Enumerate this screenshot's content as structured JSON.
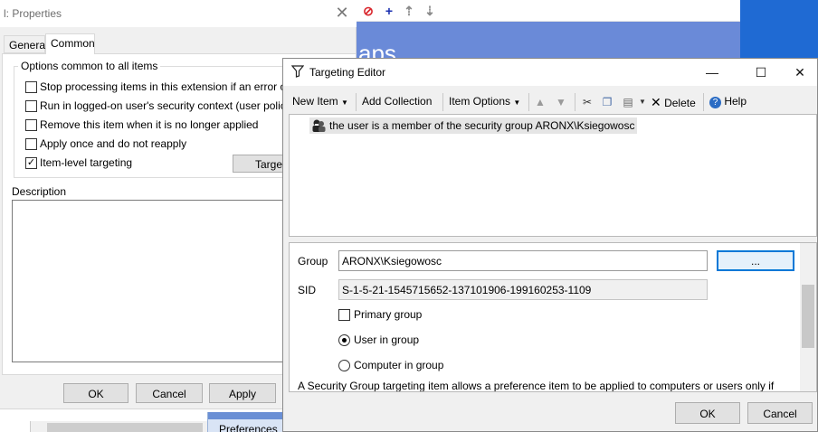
{
  "props_dialog": {
    "title": "l: Properties",
    "tabs": [
      {
        "label": "General"
      },
      {
        "label": "Common"
      }
    ],
    "options_group_label": "Options common to all items",
    "options": [
      {
        "label": "Stop processing items in this extension if an error occurs",
        "checked": false
      },
      {
        "label": "Run in logged-on user's security context (user policy opti",
        "checked": false
      },
      {
        "label": "Remove this item when it is no longer applied",
        "checked": false
      },
      {
        "label": "Apply once and do not reapply",
        "checked": false
      },
      {
        "label": "Item-level targeting",
        "checked": true
      }
    ],
    "targeting_button": "Target",
    "description_label": "Description",
    "buttons": {
      "ok": "OK",
      "cancel": "Cancel",
      "apply": "Apply"
    },
    "bottom_tab": "Preferences"
  },
  "mmc": {
    "banner_text": "aps"
  },
  "editor": {
    "title": "Targeting Editor",
    "toolbar": {
      "new_item": "New Item",
      "add_collection": "Add Collection",
      "item_options": "Item Options",
      "delete": "Delete",
      "help": "Help"
    },
    "items": [
      {
        "text": "the user is a member of the security group ARONX\\Ksiegowosc"
      }
    ],
    "detail": {
      "group_label": "Group",
      "group_value": "ARONX\\Ksiegowosc",
      "browse_label": "...",
      "sid_label": "SID",
      "sid_value": "S-1-5-21-1545715652-137101906-199160253-1109",
      "primary_group_label": "Primary group",
      "user_in_group_label": "User in group",
      "computer_in_group_label": "Computer in group",
      "selected_mode": "User in group",
      "description": "A Security Group targeting item allows a preference item to be applied to computers or users only if"
    },
    "buttons": {
      "ok": "OK",
      "cancel": "Cancel"
    }
  }
}
